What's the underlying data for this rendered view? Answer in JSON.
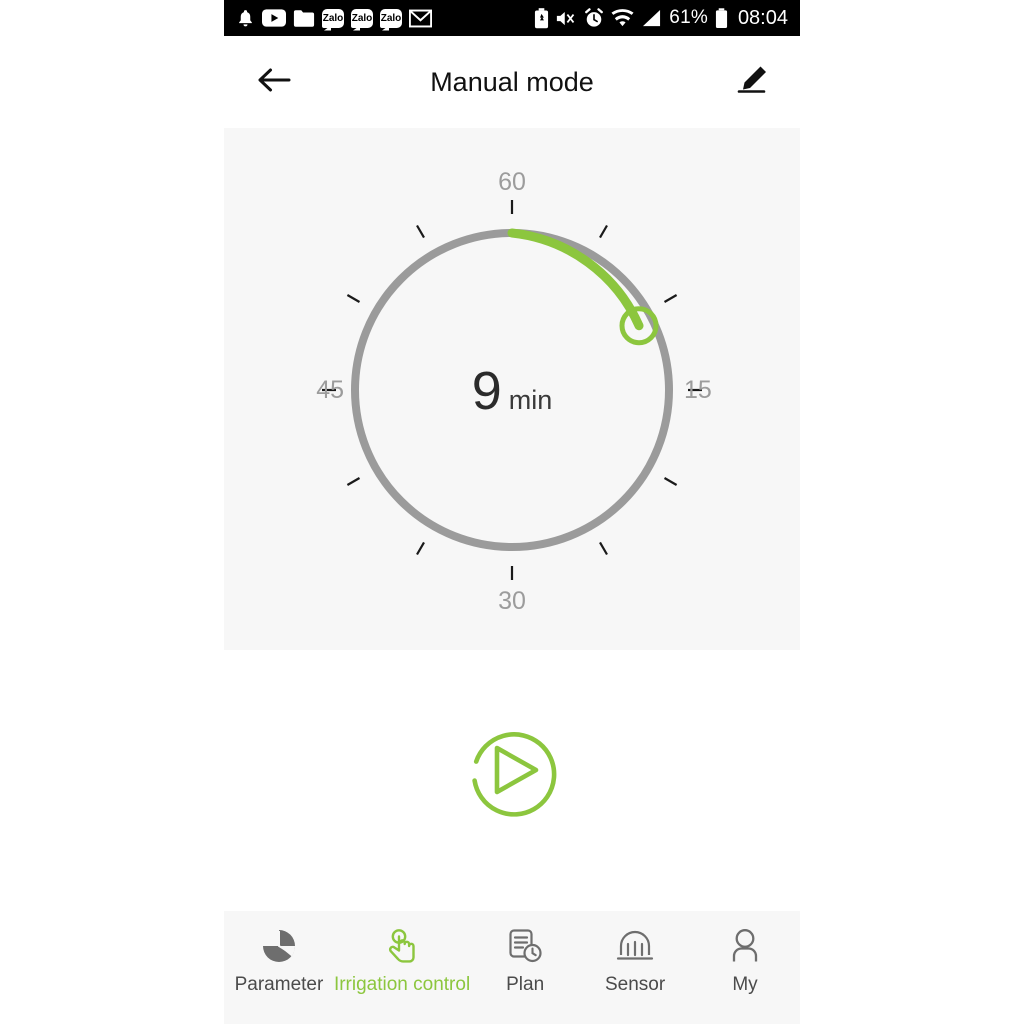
{
  "status_bar": {
    "left_icons": [
      "bell-icon",
      "youtube-icon",
      "folder-icon",
      "zalo-icon",
      "zalo-icon",
      "zalo-icon",
      "mail-icon"
    ],
    "zalo_label": "Zalo",
    "right_icons": [
      "battery-saver-icon",
      "mute-vibrate-icon",
      "alarm-icon",
      "wifi-icon",
      "signal-icon"
    ],
    "battery_percent": "61%",
    "clock": "08:04",
    "background": "#000000",
    "foreground": "#ffffff"
  },
  "header": {
    "title": "Manual mode",
    "back_icon": "arrow-left-icon",
    "edit_icon": "pencil-edit-icon"
  },
  "dial": {
    "value": "9",
    "unit": "min",
    "labels": {
      "top": "60",
      "right": "15",
      "bottom": "30",
      "left": "45"
    },
    "min": 0,
    "max": 60,
    "current": 9,
    "track_color": "#9b9b9b",
    "progress_color": "#8cc63e",
    "knob_color": "#8cc63e",
    "panel_background": "#f7f7f7",
    "tick_count": 12
  },
  "play_button": {
    "icon": "play-circle-icon",
    "color": "#8cc63e"
  },
  "bottom_nav": {
    "active_color": "#8cc63e",
    "inactive_color": "#6e6e6e",
    "items": [
      {
        "label": "Parameter",
        "icon": "pie-chart-icon",
        "active": false
      },
      {
        "label": "Irrigation control",
        "icon": "hand-tap-icon",
        "active": true
      },
      {
        "label": "Plan",
        "icon": "document-clock-icon",
        "active": false
      },
      {
        "label": "Sensor",
        "icon": "sensor-dome-icon",
        "active": false
      },
      {
        "label": "My",
        "icon": "person-icon",
        "active": false
      }
    ]
  }
}
